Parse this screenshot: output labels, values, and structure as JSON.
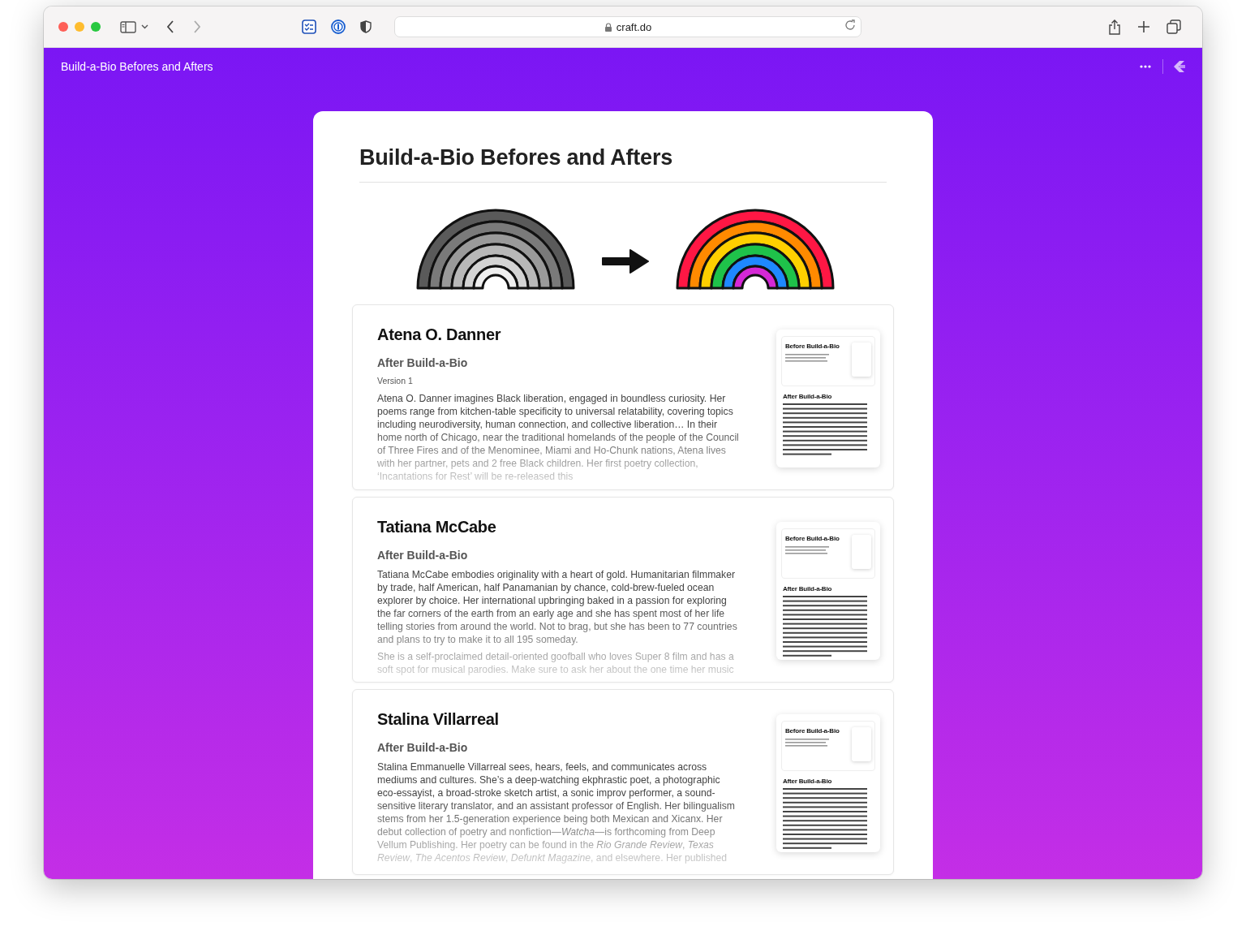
{
  "browser": {
    "url": "craft.do"
  },
  "header": {
    "title": "Build-a-Bio Befores and Afters"
  },
  "document": {
    "title": "Build-a-Bio Befores and Afters",
    "cards": [
      {
        "name": "Atena O. Danner",
        "subtitle": "After Build-a-Bio",
        "version": "Version 1",
        "paragraphs": [
          "Atena O. Danner imagines Black liberation, engaged in boundless curiosity. Her poems range from kitchen-table specificity to universal relatability, covering topics including neurodiversity, human connection, and collective liberation… In their home north of Chicago, near the traditional homelands of the people of the Council of Three Fires and of the Menominee, Miami and Ho-Chunk nations, Atena lives with her partner, pets and 2 free Black children. Her first poetry collection, ‘Incantations for Rest’ will be re-released this"
        ],
        "thumbnail": {
          "before_title": "Before Build-a-Bio",
          "after_title": "After Build-a-Bio"
        }
      },
      {
        "name": "Tatiana McCabe",
        "subtitle": "After Build-a-Bio",
        "paragraphs": [
          "Tatiana McCabe embodies originality with a heart of gold. Humanitarian filmmaker by trade, half American, half Panamanian by chance, cold-brew-fueled ocean explorer by choice. Her international upbringing baked in a passion for exploring the far corners of the earth from an early age and she has spent most of her life telling stories from around the world. Not to brag, but she has been to 77 countries and plans to try to make it to all 195 someday.",
          "She is a self-proclaimed detail-oriented goofball who loves Super 8 film and has a soft spot for musical parodies. Make sure to ask her about the one time her music"
        ],
        "thumbnail": {
          "before_title": "Before Build-a-Bio",
          "after_title": "After Build-a-Bio"
        }
      },
      {
        "name": "Stalina Villarreal",
        "subtitle": "After Build-a-Bio",
        "paragraphs": [
          "Stalina Emmanuelle Villarreal sees, hears, feels, and communicates across mediums and cultures. She’s a deep-watching ekphrastic poet, a photographic eco-essayist, a broad-stroke sketch artist, a sonic improv performer, a sound-sensitive literary translator, and an assistant professor of English. Her bilingualism stems from her 1.5-generation experience being both Mexican and Xicanx. Her debut collection of poetry and nonfiction—*Watcha*—is forthcoming from Deep Vellum Publishing. Her poetry can be found in the *Rio Grande Review*, *Texas Review*, *The Acentos Review*, *Defunkt Magazine*, and elsewhere. Her published"
        ],
        "thumbnail": {
          "before_title": "Before Build-a-Bio",
          "after_title": "After Build-a-Bio"
        }
      }
    ]
  }
}
